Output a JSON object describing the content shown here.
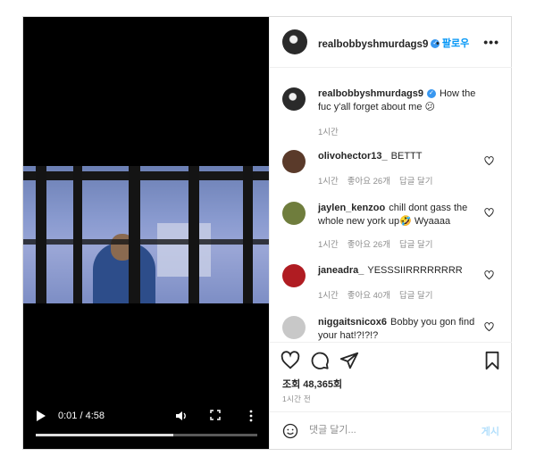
{
  "video": {
    "time": "0:01 / 4:58",
    "progress": 0.62
  },
  "header": {
    "username": "realbobbyshmurdags9",
    "verified": "✓",
    "separator": "•",
    "follow_label": "팔로우",
    "more": "•••"
  },
  "caption": {
    "username": "realbobbyshmurdags9",
    "text": "How the fuc y'all forget about me 😕",
    "time": "1시간"
  },
  "comments": [
    {
      "username": "olivohector13_",
      "text": "BETTT",
      "time": "1시간",
      "likes": "좋아요 26개",
      "reply": "답글 달기",
      "avatar_color": "#5a3a2a"
    },
    {
      "username": "jaylen_kenzoo",
      "text": "chill dont gass the whole new york up🤣 Wyaaaa",
      "time": "1시간",
      "likes": "좋아요 26개",
      "reply": "답글 달기",
      "avatar_color": "#6f7d3d"
    },
    {
      "username": "janeadra_",
      "text": "YESSSIIRRRRRRRR",
      "time": "1시간",
      "likes": "좋아요 40개",
      "reply": "답글 달기",
      "avatar_color": "#b01c22"
    },
    {
      "username": "niggaitsnicox6",
      "text": "Bobby you gon find your hat!?!?!?",
      "time": "",
      "likes": "",
      "reply": "",
      "avatar_color": "#c8c8c8"
    }
  ],
  "actions": {
    "views": "조회 48,365회",
    "ago": "1시간 전"
  },
  "add_comment": {
    "placeholder": "댓글 달기...",
    "post_label": "게시"
  },
  "icons": [
    "play-icon",
    "volume-icon",
    "fullscreen-icon",
    "more-vertical-icon",
    "heart-icon",
    "comment-icon",
    "share-icon",
    "bookmark-icon",
    "emoji-icon"
  ]
}
